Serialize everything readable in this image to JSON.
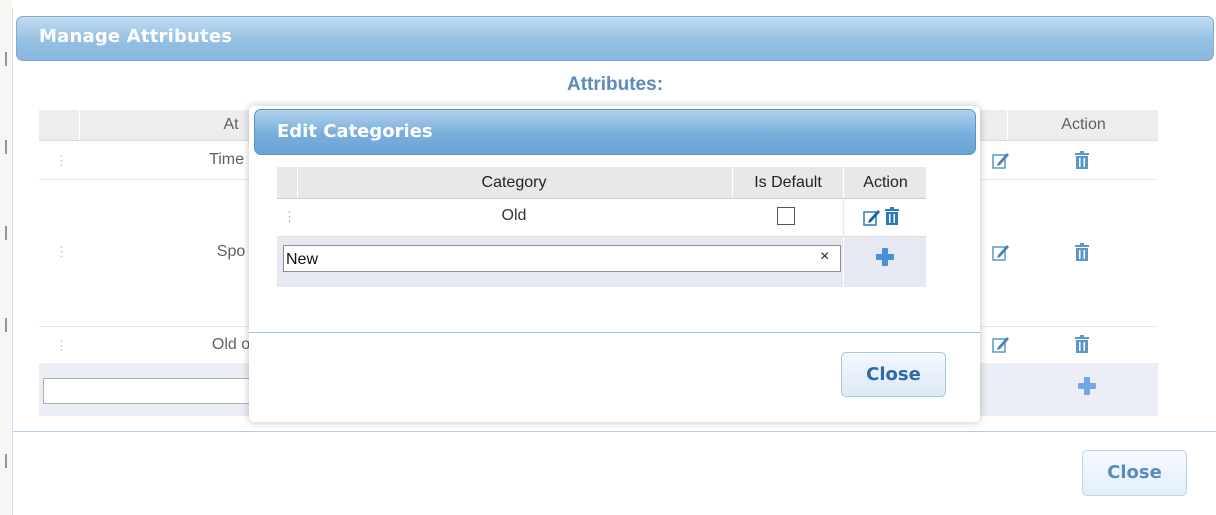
{
  "outer_dialog": {
    "title": "Manage Attributes",
    "heading": "Attributes:",
    "table": {
      "header_attribute": "At",
      "header_action": "Action",
      "rows": [
        {
          "name": "Time I"
        },
        {
          "name": "Spo"
        },
        {
          "name": "Old o"
        }
      ]
    },
    "close_label": "Close"
  },
  "inner_dialog": {
    "title": "Edit Categories",
    "columns": {
      "category": "Category",
      "is_default": "Is Default",
      "action": "Action"
    },
    "rows": [
      {
        "category": "Old",
        "is_default": false
      }
    ],
    "new_category_input": {
      "value": "New",
      "clear_symbol": "×"
    },
    "close_label": "Close"
  },
  "icons": {
    "edit": "pencil-edit-icon",
    "delete": "trash-icon",
    "add": "plus-icon",
    "drag": "drag-handle-icon"
  },
  "colors": {
    "titlebar": "#78aedc",
    "heading": "#2e6aa8",
    "icon_blue": "#2b7bb9",
    "plus_blue": "#4a90d9"
  }
}
